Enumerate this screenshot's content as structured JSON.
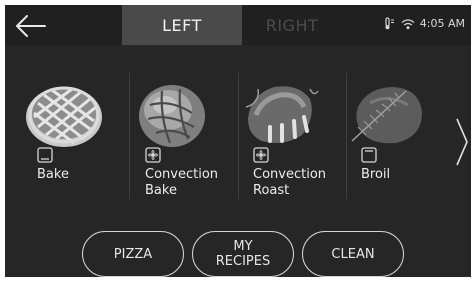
{
  "tabs": [
    {
      "label": "LEFT",
      "active": true
    },
    {
      "label": "RIGHT",
      "active": false
    }
  ],
  "status": {
    "time": "4:05 AM"
  },
  "modes": [
    {
      "label": "Bake",
      "icon": "bake-element-icon",
      "image": "pie"
    },
    {
      "label": "Convection\nBake",
      "icon": "convection-fan-icon",
      "image": "bread"
    },
    {
      "label": "Convection\nRoast",
      "icon": "convection-fan-icon",
      "image": "ribs"
    },
    {
      "label": "Broil",
      "icon": "broil-element-icon",
      "image": "steak"
    }
  ],
  "buttons": [
    {
      "label": "PIZZA"
    },
    {
      "label": "MY\nRECIPES"
    },
    {
      "label": "CLEAN"
    }
  ],
  "colors": {
    "screen": "#262626",
    "active_tab": "#4a4a4a",
    "text": "#ececec",
    "inactive_tab_text": "#4c4c4c"
  }
}
